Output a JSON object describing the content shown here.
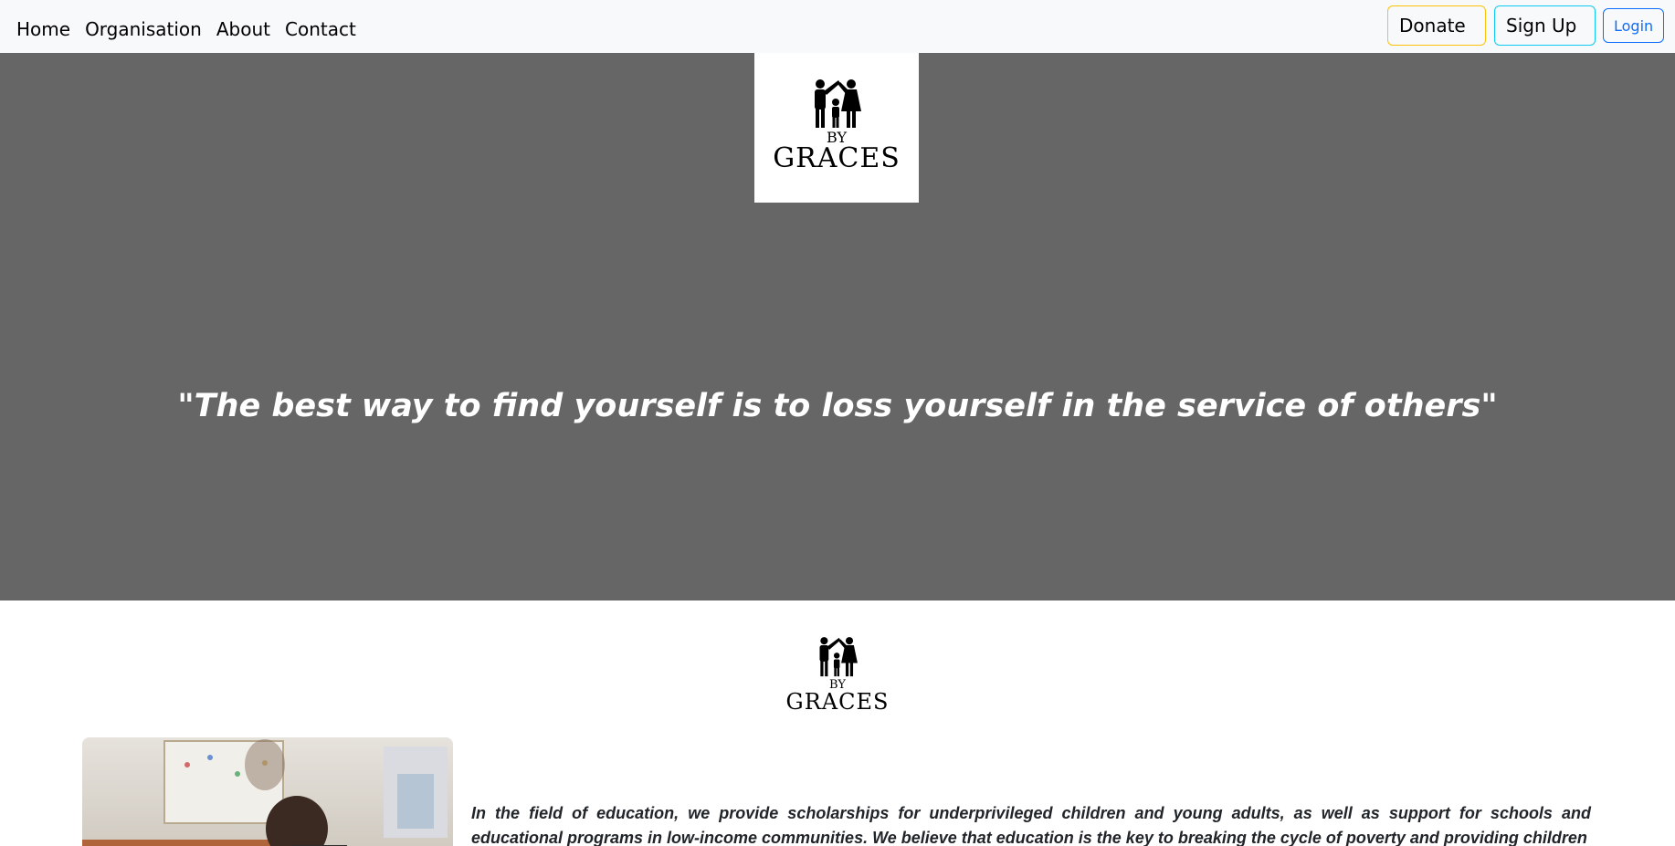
{
  "nav": {
    "links": [
      "Home",
      "Organisation",
      "About",
      "Contact"
    ],
    "donate_label": "Donate",
    "signup_label": "Sign Up",
    "login_label": "Login"
  },
  "logo": {
    "by": "BY",
    "name": "GRACES",
    "icon": "family-home-icon"
  },
  "hero": {
    "quote": "\"The best way to find yourself is to loss yourself in the service of others\""
  },
  "content": {
    "photo_icon": "classroom-child-photo",
    "paragraph": "In the field of education, we provide scholarships for underprivileged children and young adults, as well as support for schools and educational programs in low-income communities. We believe that education is the key to breaking the cycle of poverty and providing children"
  },
  "colors": {
    "navbar_bg": "#f8f9fa",
    "hero_bg": "#666666",
    "donate_border": "#ffc107",
    "signup_border": "#0dcaf0",
    "login_border": "#0d6efd"
  }
}
